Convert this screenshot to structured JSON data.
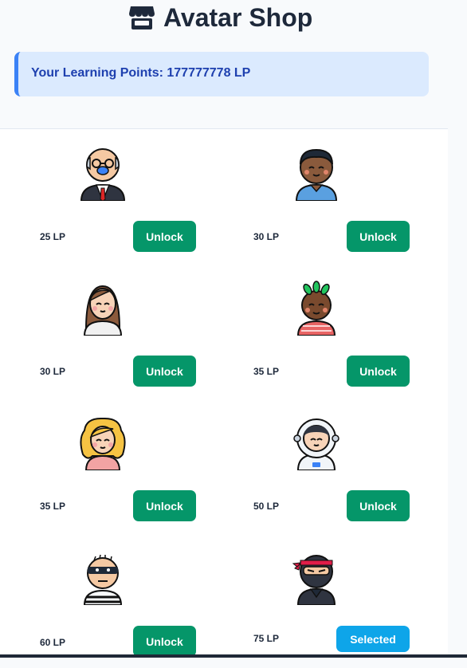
{
  "page": {
    "title": "Avatar Shop",
    "title_icon": "store-icon",
    "points_text": "Your Learning Points: 177777778 LP"
  },
  "avatars": [
    {
      "name": "old-man",
      "price": "25 LP",
      "button": "Unlock",
      "state": "locked"
    },
    {
      "name": "boy-dark",
      "price": "30 LP",
      "button": "Unlock",
      "state": "locked"
    },
    {
      "name": "girl-brown-hair",
      "price": "30 LP",
      "button": "Unlock",
      "state": "locked"
    },
    {
      "name": "kid-green-locs",
      "price": "35 LP",
      "button": "Unlock",
      "state": "locked"
    },
    {
      "name": "girl-blonde",
      "price": "35 LP",
      "button": "Unlock",
      "state": "locked"
    },
    {
      "name": "astronaut",
      "price": "50 LP",
      "button": "Unlock",
      "state": "locked"
    },
    {
      "name": "burglar",
      "price": "60 LP",
      "button": "Unlock",
      "state": "locked"
    },
    {
      "name": "ninja",
      "price": "75 LP",
      "button": "Selected",
      "state": "selected"
    }
  ],
  "colors": {
    "unlock_button": "#059669",
    "selected_button": "#0ea5e9",
    "points_bg": "#dbeafe",
    "points_border": "#3b82f6",
    "points_text": "#1e40af"
  }
}
